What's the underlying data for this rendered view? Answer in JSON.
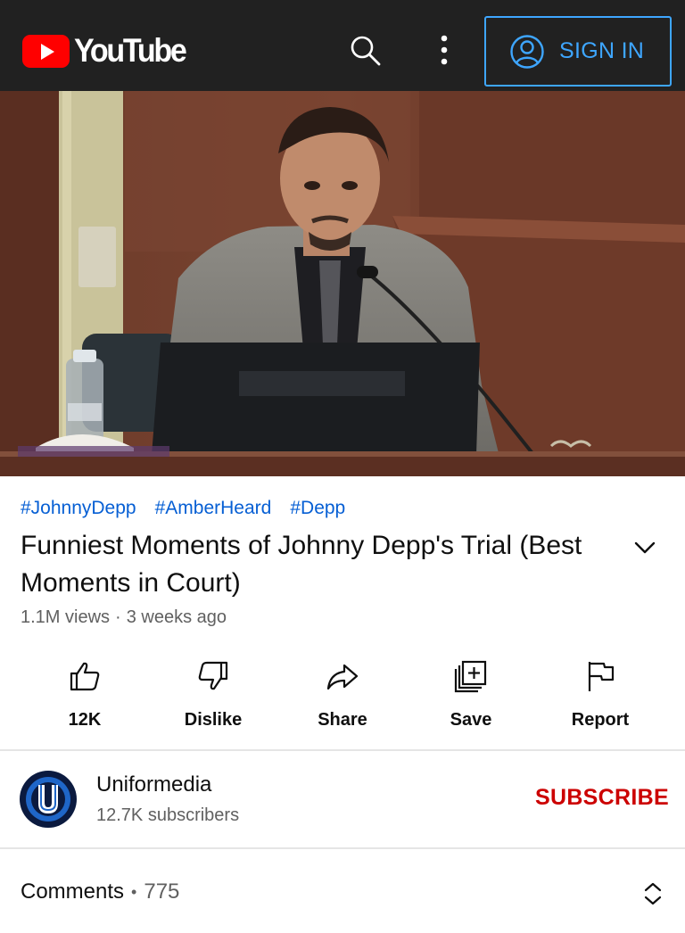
{
  "header": {
    "logo_text": "YouTube",
    "sign_in_label": "SIGN IN",
    "icons": [
      "search-icon",
      "more-vert-icon",
      "account-circle-icon"
    ],
    "accent_color": "#3ea6ff",
    "brand_color": "#ff0000"
  },
  "video": {
    "hashtags": [
      "#JohnnyDepp",
      "#AmberHeard",
      "#Depp"
    ],
    "title": "Funniest Moments of Johnny Depp's Trial (Best Moments in Court)",
    "views": "1.1M views",
    "separator": "·",
    "age": "3 weeks ago"
  },
  "actions": {
    "like": "12K",
    "dislike": "Dislike",
    "share": "Share",
    "save": "Save",
    "report": "Report"
  },
  "channel": {
    "name": "Uniformedia",
    "subscribers": "12.7K subscribers",
    "subscribe_label": "SUBSCRIBE",
    "subscribe_color": "#cc0000"
  },
  "comments": {
    "label": "Comments",
    "separator": "•",
    "count": "775"
  }
}
